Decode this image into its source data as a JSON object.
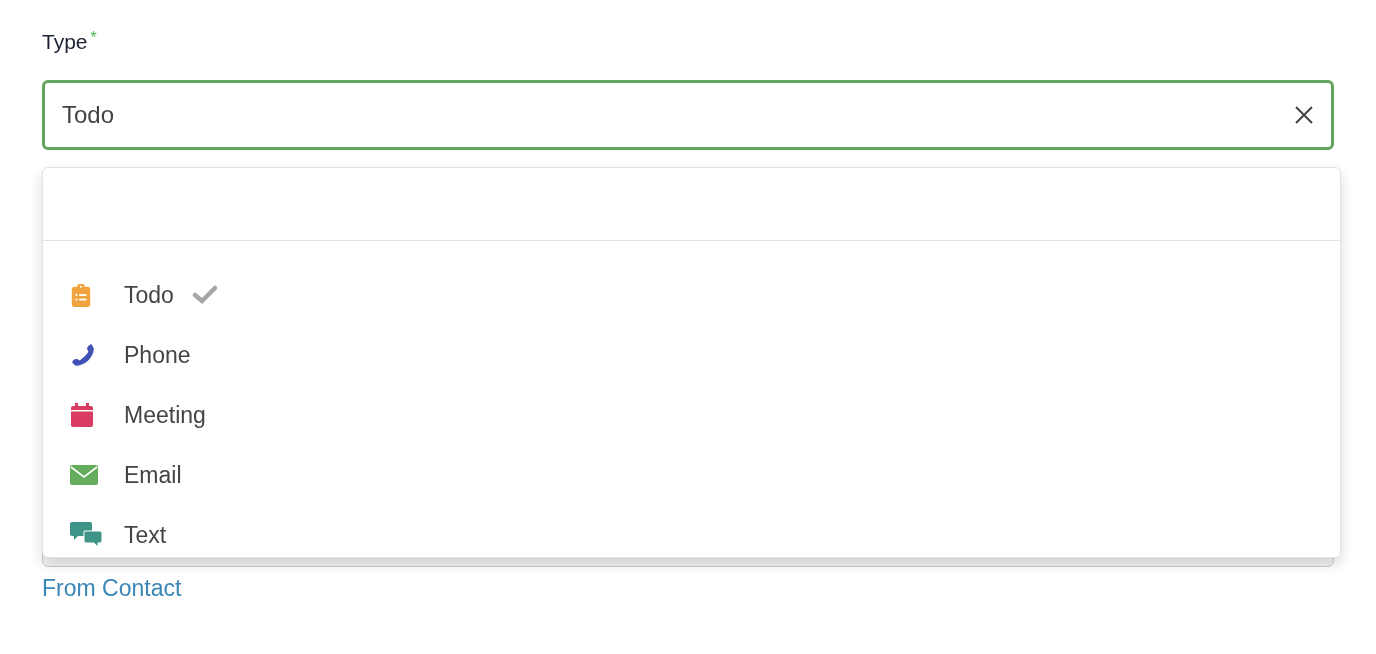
{
  "field": {
    "label": "Type",
    "required_mark": "*",
    "value": "Todo",
    "focused": true
  },
  "dropdown": {
    "items": [
      {
        "kind": "clipboard",
        "label": "Todo",
        "color": "#f0a23c",
        "selected": true
      },
      {
        "kind": "phone",
        "label": "Phone",
        "color": "#4150b5",
        "selected": false
      },
      {
        "kind": "calendar",
        "label": "Meeting",
        "color": "#d93b63",
        "selected": false
      },
      {
        "kind": "envelope",
        "label": "Email",
        "color": "#64ad5c",
        "selected": false
      },
      {
        "kind": "chat",
        "label": "Text",
        "color": "#3f9488",
        "selected": false
      }
    ]
  },
  "link": "From Contact"
}
